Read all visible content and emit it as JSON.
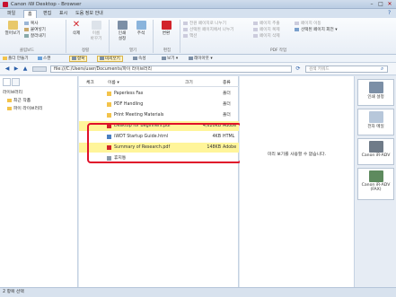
{
  "window": {
    "title": "Canon iW Desktop - Browser",
    "minimize": "–",
    "maximize": "□",
    "close": "✕"
  },
  "tabs": [
    "파일",
    "홈",
    "편집",
    "표시",
    "도움 정보 안내"
  ],
  "active_tab": "홈",
  "help_glyph": "?",
  "ribbon": {
    "open": "열어보기",
    "copy": "복사",
    "paste": "붙여넣기",
    "cut": "잘라내기",
    "delete": "삭제",
    "rename_line1": "이름",
    "rename_line2": "바꾸기",
    "print_line1": "인쇄",
    "print_line2": "설정",
    "annotate": "주석",
    "convert": "변환",
    "pdf_items": [
      "전원 페이지로 나누기",
      "선택된 페이지에서 나누기",
      "액션"
    ],
    "page_items": [
      "페이지 추출",
      "페이지 복제",
      "페이지 삭제"
    ],
    "page_right": [
      "페이지 이동",
      "선택된 페이지 회전 ▾"
    ],
    "groups": [
      "클립보드",
      "정렬",
      "열기",
      "편집",
      "PDF 작업"
    ]
  },
  "toolbar": {
    "items": [
      "폴더 만들기",
      "스캔",
      "항목",
      "미리보기",
      "속성",
      "보기 ▾",
      "레이아웃 ▾"
    ],
    "pressed": [
      false,
      false,
      true,
      true,
      false,
      false,
      false
    ]
  },
  "address": {
    "back": "◀",
    "forward": "▶",
    "up": "▲",
    "path": "file:///C:/Users/user/Documents/파이 라이브러리",
    "search_placeholder": "검색 키워드"
  },
  "tree": {
    "root": "라이브러리",
    "items": [
      "최근 작품",
      "파이 라이브러리"
    ]
  },
  "filelist": {
    "columns": [
      "체크",
      "이름 ▾",
      "크기",
      "종류"
    ],
    "rows": [
      {
        "name": "Paperless Fax",
        "size": "",
        "type": "폴더",
        "kind": "folder",
        "selected": false
      },
      {
        "name": "PDF Handling",
        "size": "",
        "type": "폴더",
        "kind": "folder",
        "selected": false
      },
      {
        "name": "Print Meeting Materials",
        "size": "",
        "type": "폴더",
        "kind": "folder",
        "selected": false
      },
      {
        "name": "Desktop for Beginners.pdf",
        "size": "4,620KB",
        "type": "Adobe",
        "kind": "pdf",
        "selected": true
      },
      {
        "name": "iWDT Startup Guide.html",
        "size": "4KB",
        "type": "HTML",
        "kind": "html",
        "selected": false
      },
      {
        "name": "Summary of Research.pdf",
        "size": "148KB",
        "type": "Adobe",
        "kind": "pdf",
        "selected": true
      },
      {
        "name": "휴지통",
        "size": "",
        "type": "",
        "kind": "trash",
        "selected": false
      }
    ]
  },
  "preview": {
    "message": "미리 보기를 사용할 수 없습니다."
  },
  "right_pane": {
    "items": [
      "인쇄 설정",
      "전자 메일",
      "Canon iR-ADV",
      "Canon iR-ADV (FAX)"
    ]
  },
  "status": {
    "text": "2 항목 선택"
  },
  "colors": {
    "selection": "#fff59a",
    "highlight_box": "#e0102a",
    "pdf": "#d2232a",
    "folder": "#f3c34a"
  }
}
